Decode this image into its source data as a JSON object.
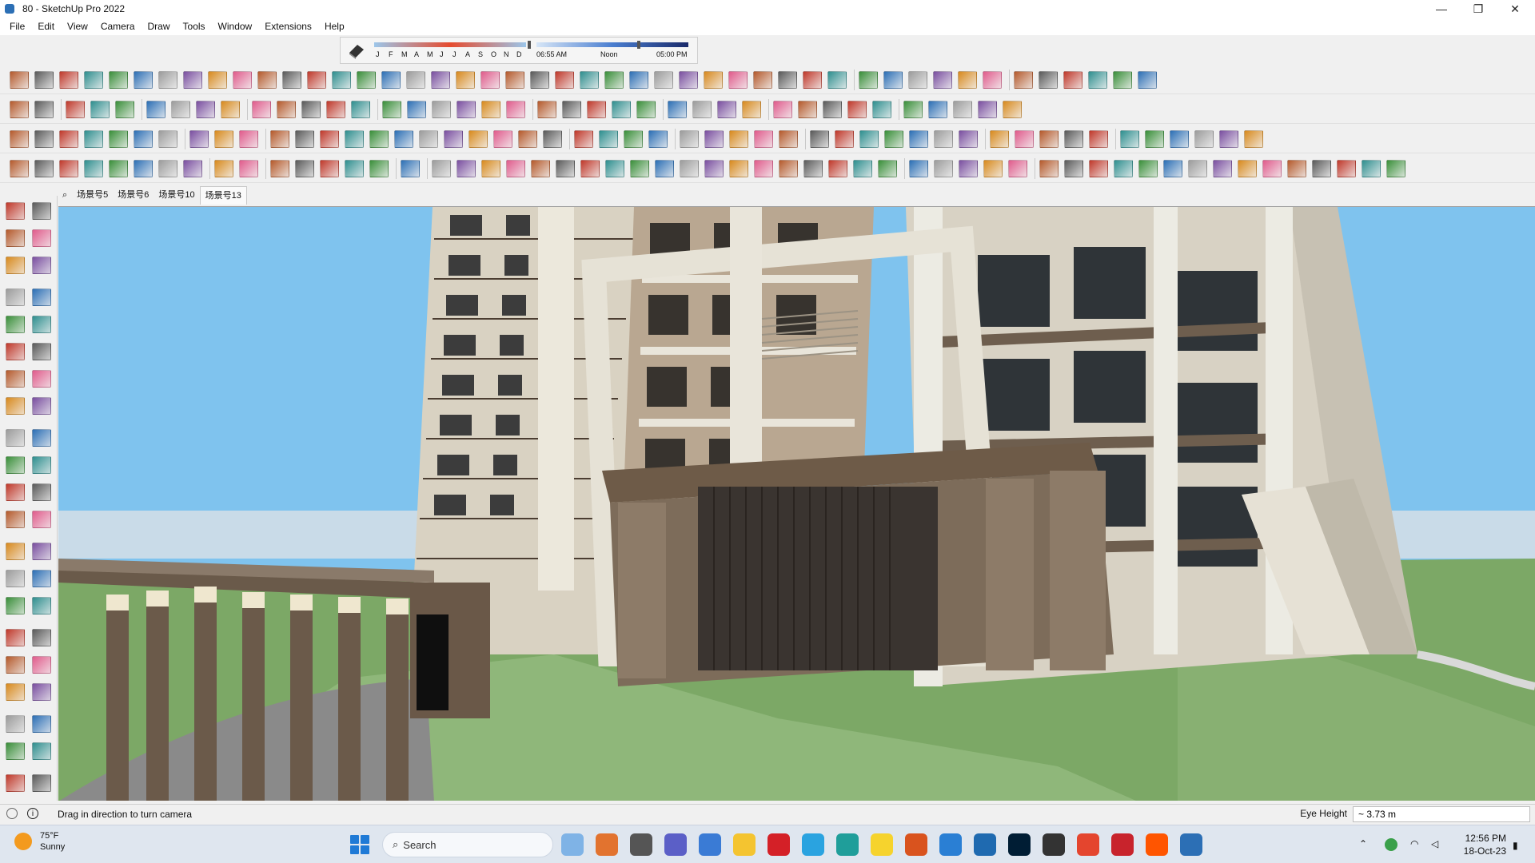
{
  "window": {
    "title": "80 - SketchUp Pro 2022",
    "minimize_glyph": "—",
    "maximize_glyph": "❐",
    "close_glyph": "✕"
  },
  "menu": [
    "File",
    "Edit",
    "View",
    "Camera",
    "Draw",
    "Tools",
    "Window",
    "Extensions",
    "Help"
  ],
  "shadow_toolbar": {
    "months": [
      "J",
      "F",
      "M",
      "A",
      "M",
      "J",
      "J",
      "A",
      "S",
      "O",
      "N",
      "D"
    ],
    "sunrise": "06:55 AM",
    "noon": "Noon",
    "sunset": "05:00 PM"
  },
  "scenes": [
    "场景号5",
    "场景号6",
    "场景号10",
    "场景号13"
  ],
  "active_scene": "场景号13",
  "status": {
    "message": "Drag in direction to turn camera",
    "eye_height_label": "Eye Height",
    "eye_height_value": "~ 3.73 m"
  },
  "taskbar": {
    "weather_temp": "75°F",
    "weather_cond": "Sunny",
    "search_placeholder": "Search",
    "time": "12:56 PM",
    "date": "18-Oct-23"
  },
  "colors": {
    "sky": "#7cc3ef",
    "grass": "#7aa664",
    "facade_light": "#e8e4d8",
    "facade_brown": "#7b6a58",
    "accent": "#2c6fb5"
  }
}
